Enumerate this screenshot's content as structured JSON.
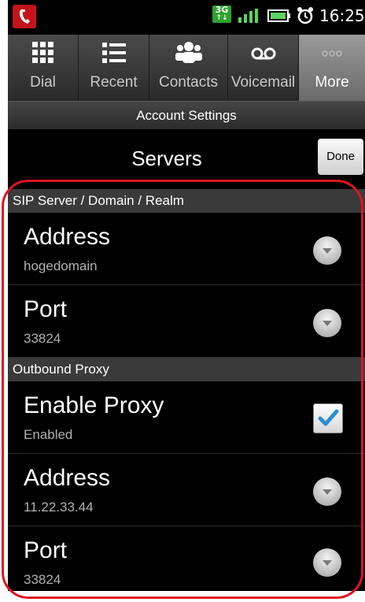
{
  "status": {
    "network": "3G",
    "time": "16:25"
  },
  "tabs": [
    {
      "label": "Dial",
      "icon": "dialpad-icon"
    },
    {
      "label": "Recent",
      "icon": "list-icon"
    },
    {
      "label": "Contacts",
      "icon": "contacts-icon"
    },
    {
      "label": "Voicemail",
      "icon": "voicemail-icon"
    },
    {
      "label": "More",
      "icon": "more-icon",
      "active": true
    }
  ],
  "title_bar": "Account Settings",
  "page": {
    "title": "Servers",
    "done_label": "Done"
  },
  "sections": [
    {
      "header": "SIP Server / Domain / Realm",
      "rows": [
        {
          "title": "Address",
          "value": "hogedomain",
          "control": "dropdown"
        },
        {
          "title": "Port",
          "value": "33824",
          "control": "dropdown"
        }
      ]
    },
    {
      "header": "Outbound Proxy",
      "rows": [
        {
          "title": "Enable Proxy",
          "value": "Enabled",
          "control": "checkbox",
          "checked": true
        },
        {
          "title": "Address",
          "value": "11.22.33.44",
          "control": "dropdown"
        },
        {
          "title": "Port",
          "value": "33824",
          "control": "dropdown"
        }
      ]
    }
  ],
  "colors": {
    "highlight": "#e0141e",
    "checkmark": "#2b8fd6",
    "network_badge": "#2fa32f"
  }
}
